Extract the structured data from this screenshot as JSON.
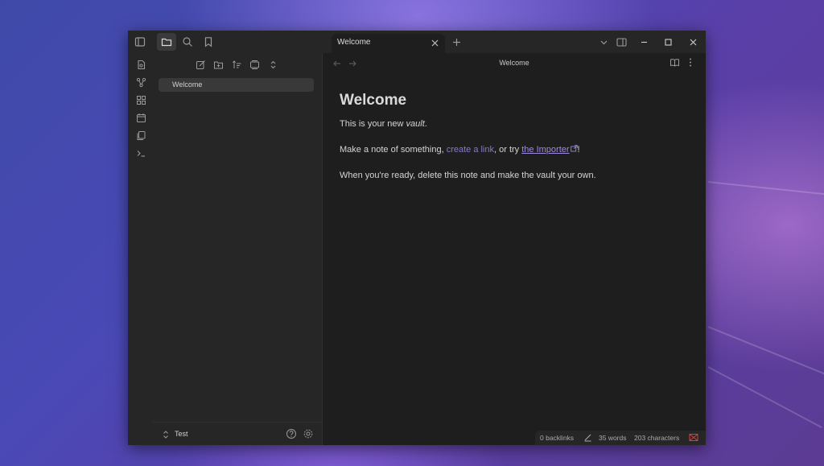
{
  "window": {
    "tab": {
      "label": "Welcome"
    }
  },
  "sidebar": {
    "files": [
      {
        "label": "Welcome"
      }
    ],
    "vault_name": "Test"
  },
  "note": {
    "header_title": "Welcome",
    "heading": "Welcome",
    "p1_before": "This is your new ",
    "p1_em": "vault",
    "p1_after": ".",
    "p2_before": "Make a note of something, ",
    "p2_link": "create a link",
    "p2_middle": ", or try ",
    "p2_ext_link": "the Importer",
    "p2_after": "!",
    "p3": "When you're ready, delete this note and make the vault your own."
  },
  "statusbar": {
    "backlinks": "0 backlinks",
    "words": "35 words",
    "characters": "203 characters"
  },
  "colors": {
    "accent": "#8a74d6",
    "background": "#1e1e1e",
    "panel": "#262626"
  }
}
